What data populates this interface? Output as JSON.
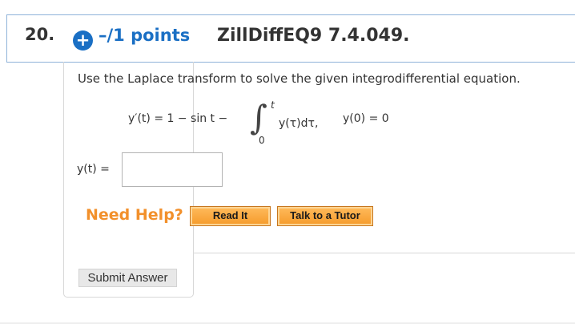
{
  "question": {
    "number": "20.",
    "plus_icon": "plus-circle-icon",
    "points": "–/1 points",
    "problem_id": "ZillDiffEQ9 7.4.049."
  },
  "problem": {
    "instruction": "Use the Laplace transform to solve the given integrodifferential equation.",
    "equation": {
      "lhs": "y′(t)  =  1  −  sin t  −",
      "integral_upper": "t",
      "integral_lower": "0",
      "integrand": "y(τ)dτ,",
      "initial_condition": "y(0)  =  0"
    }
  },
  "answer": {
    "label": "y(t)  =",
    "value": ""
  },
  "help": {
    "label": "Need Help?",
    "read_it": "Read It",
    "talk_tutor": "Talk to a Tutor"
  },
  "submit": {
    "label": "Submit Answer"
  },
  "colors": {
    "accent_blue": "#1a6fc4",
    "help_orange": "#f2902b",
    "button_orange": "#f59a2a"
  }
}
